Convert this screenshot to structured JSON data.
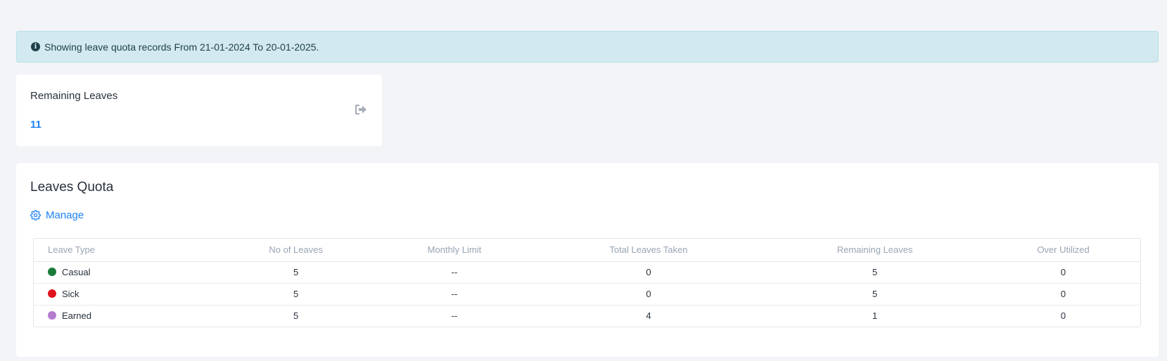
{
  "alert": {
    "icon": "info-circle-icon",
    "text": "Showing leave quota records From 21-01-2024 To 20-01-2025."
  },
  "remaining_card": {
    "title": "Remaining Leaves",
    "value": "11",
    "icon": "sign-out-icon"
  },
  "quota": {
    "heading": "Leaves Quota",
    "manage_label": "Manage",
    "manage_icon": "gear-icon",
    "columns": [
      "Leave Type",
      "No of Leaves",
      "Monthly Limit",
      "Total Leaves Taken",
      "Remaining Leaves",
      "Over Utilized"
    ],
    "rows": [
      {
        "type": "Casual",
        "color": "#1a7a3a",
        "no_of_leaves": "5",
        "monthly_limit": "--",
        "taken": "0",
        "remaining": "5",
        "over_utilized": "0"
      },
      {
        "type": "Sick",
        "color": "#e0141e",
        "no_of_leaves": "5",
        "monthly_limit": "--",
        "taken": "0",
        "remaining": "5",
        "over_utilized": "0"
      },
      {
        "type": "Earned",
        "color": "#b57ccf",
        "no_of_leaves": "5",
        "monthly_limit": "--",
        "taken": "4",
        "remaining": "1",
        "over_utilized": "0"
      }
    ]
  },
  "colors": {
    "accent": "#1d82f5",
    "alert_bg": "#d1e9ef",
    "page_bg": "#f2f4f7"
  }
}
